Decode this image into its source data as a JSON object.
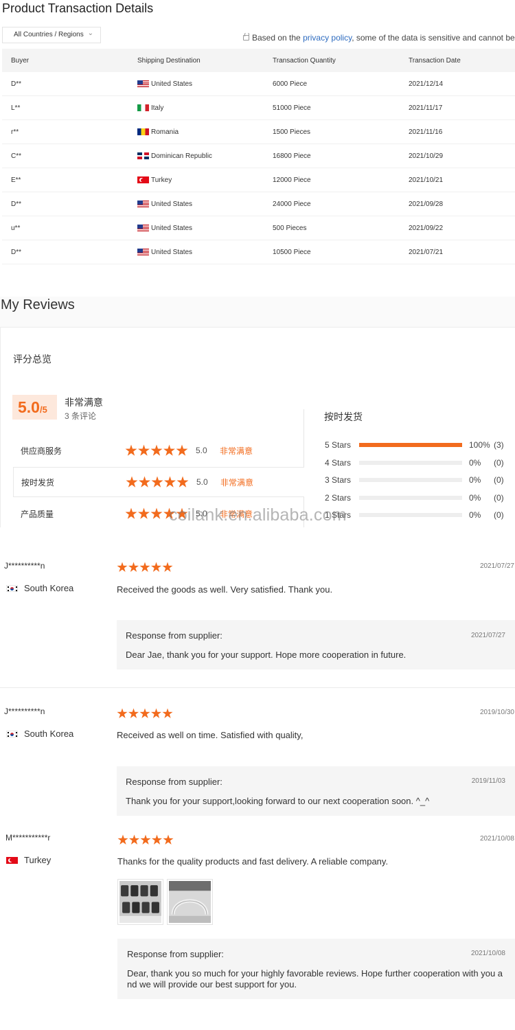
{
  "transactions": {
    "title": "Product Transaction Details",
    "region_select": "All Countries / Regions",
    "policy_prefix": "Based on the ",
    "policy_link": "privacy policy",
    "policy_suffix": ", some of the data is sensitive and cannot be",
    "columns": [
      "Buyer",
      "Shipping Destination",
      "Transaction Quantity",
      "Transaction Date"
    ],
    "rows": [
      {
        "buyer": "D**",
        "flag": "us",
        "destination": "United States",
        "quantity": "6000 Piece",
        "date": "2021/12/14"
      },
      {
        "buyer": "L**",
        "flag": "it",
        "destination": "Italy",
        "quantity": "51000 Piece",
        "date": "2021/11/17"
      },
      {
        "buyer": "r**",
        "flag": "ro",
        "destination": "Romania",
        "quantity": "1500 Pieces",
        "date": "2021/11/16"
      },
      {
        "buyer": "C**",
        "flag": "do",
        "destination": "Dominican Republic",
        "quantity": "16800 Piece",
        "date": "2021/10/29"
      },
      {
        "buyer": "E**",
        "flag": "tr",
        "destination": "Turkey",
        "quantity": "12000 Piece",
        "date": "2021/10/21"
      },
      {
        "buyer": "D**",
        "flag": "us",
        "destination": "United States",
        "quantity": "24000 Piece",
        "date": "2021/09/28"
      },
      {
        "buyer": "u**",
        "flag": "us",
        "destination": "United States",
        "quantity": "500 Pieces",
        "date": "2021/09/22"
      },
      {
        "buyer": "D**",
        "flag": "us",
        "destination": "United States",
        "quantity": "10500 Piece",
        "date": "2021/07/21"
      }
    ]
  },
  "reviews": {
    "title": "My Reviews",
    "overview_title": "评分总览",
    "score": "5.0",
    "score_max": "/5",
    "score_label": "非常满意",
    "review_count": "3 条评论",
    "metrics": [
      {
        "name": "供应商服务",
        "rating": 5,
        "score": "5.0",
        "verdict": "非常满意"
      },
      {
        "name": "按时发货",
        "rating": 5,
        "score": "5.0",
        "verdict": "非常满意"
      },
      {
        "name": "产品质量",
        "rating": 5,
        "score": "5.0",
        "verdict": "非常满意"
      }
    ],
    "distribution_title": "按时发货",
    "distribution": [
      {
        "label": "5 Stars",
        "fraction": 1.0,
        "pct": "100%",
        "count": "(3)"
      },
      {
        "label": "4 Stars",
        "fraction": 0,
        "pct": "0%",
        "count": "(0)"
      },
      {
        "label": "3 Stars",
        "fraction": 0,
        "pct": "0%",
        "count": "(0)"
      },
      {
        "label": "2 Stars",
        "fraction": 0,
        "pct": "0%",
        "count": "(0)"
      },
      {
        "label": "1 Stars",
        "fraction": 0,
        "pct": "0%",
        "count": "(0)"
      }
    ],
    "watermark": "coilank.en.alibaba.com",
    "items": [
      {
        "name": "J**********n",
        "country": "South Korea",
        "flag": "kr",
        "rating": 5,
        "date": "2021/07/27",
        "text": "Received the goods as well. Very satisfied. Thank you.",
        "response_title": "Response from supplier:",
        "response_date": "2021/07/27",
        "response_text": "Dear Jae, thank you for your support. Hope more cooperation in future."
      },
      {
        "name": "J**********n",
        "country": "South Korea",
        "flag": "kr",
        "rating": 5,
        "date": "2019/10/30",
        "text": "Received as well on time. Satisfied with quality,",
        "response_title": "Response from supplier:",
        "response_date": "2019/11/03",
        "response_text": "Thank you for your support,looking forward to our next cooperation soon. ^_^"
      },
      {
        "name": "M***********r",
        "country": "Turkey",
        "flag": "tr",
        "rating": 5,
        "date": "2021/10/08",
        "text": "Thanks for the quality products and fast delivery. A reliable company.",
        "response_title": "Response from supplier:",
        "response_date": "2021/10/08",
        "response_text_line1": "Dear, thank you so much for your highly favorable reviews. Hope further cooperation with you a",
        "response_text_line2": "nd we will provide our best support for you."
      }
    ]
  },
  "colors": {
    "accent": "#f26b1d",
    "link": "#2d6bbf",
    "score_bg": "#fde8dc"
  }
}
